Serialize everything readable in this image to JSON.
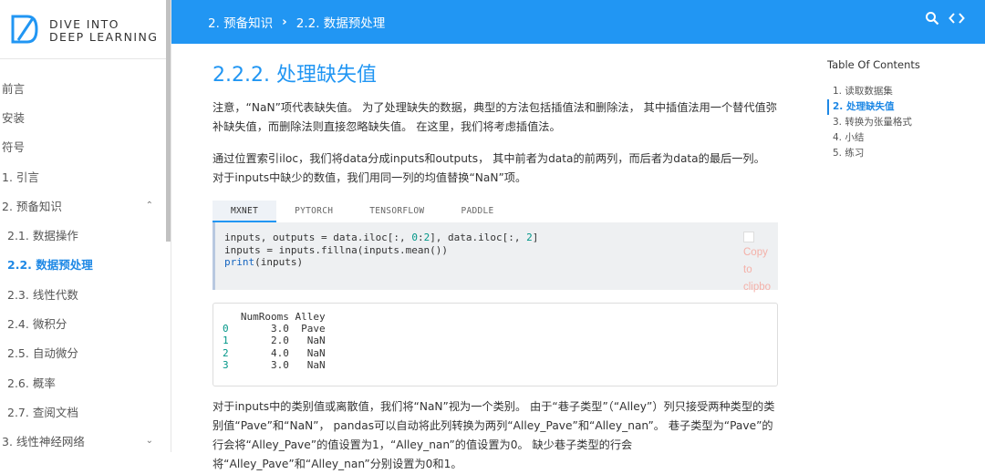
{
  "logo": {
    "line1": "DIVE INTO",
    "line2": "DEEP LEARNING"
  },
  "sidebar": {
    "items": [
      {
        "label": "前言",
        "sub": false
      },
      {
        "label": "安装",
        "sub": false
      },
      {
        "label": "符号",
        "sub": false
      },
      {
        "label": "1. 引言",
        "sub": false
      },
      {
        "label": "2. 预备知识",
        "sub": false,
        "chevron": "^"
      },
      {
        "label": "2.1. 数据操作",
        "sub": true
      },
      {
        "label": "2.2. 数据预处理",
        "sub": true,
        "active": true
      },
      {
        "label": "2.3. 线性代数",
        "sub": true
      },
      {
        "label": "2.4. 微积分",
        "sub": true
      },
      {
        "label": "2.5. 自动微分",
        "sub": true
      },
      {
        "label": "2.6. 概率",
        "sub": true
      },
      {
        "label": "2.7. 查阅文档",
        "sub": true
      },
      {
        "label": "3. 线性神经网络",
        "sub": false,
        "chevron": "v"
      }
    ]
  },
  "header": {
    "crumb1": "2. 预备知识",
    "sep": "›",
    "crumb2": "2.2. 数据预处理",
    "icons": [
      "search-icon",
      "code-icon"
    ],
    "color": "#2196f3"
  },
  "main": {
    "title": "2.2.2. 处理缺失值",
    "para1": "注意，“NaN”项代表缺失值。 为了处理缺失的数据，典型的方法包括插值法和删除法， 其中插值法用一个替代值弥补缺失值，而删除法则直接忽略缺失值。 在这里，我们将考虑插值法。",
    "para2": "通过位置索引iloc，我们将data分成inputs和outputs， 其中前者为data的前两列，而后者为data的最后一列。 对于inputs中缺少的数值，我们用同一列的均值替换“NaN”项。",
    "tabs": [
      "MXNET",
      "PYTORCH",
      "TENSORFLOW",
      "PADDLE"
    ],
    "copy_label": "Copy to clipbo",
    "output_header": "   NumRooms Alley",
    "output_rows": [
      {
        "idx": "0",
        "rest": "       3.0  Pave"
      },
      {
        "idx": "1",
        "rest": "       2.0   NaN"
      },
      {
        "idx": "2",
        "rest": "       4.0   NaN"
      },
      {
        "idx": "3",
        "rest": "       3.0   NaN"
      }
    ],
    "para3": "对于inputs中的类别值或离散值，我们将“NaN”视为一个类别。 由于“巷子类型”（“Alley”）列只接受两种类型的类别值“Pave”和“NaN”， pandas可以自动将此列转换为两列“Alley_Pave”和“Alley_nan”。 巷子类型为“Pave”的行会将“Alley_Pave”的值设置为1，“Alley_nan”的值设置为0。 缺少巷子类型的行会将“Alley_Pave”和“Alley_nan”分别设置为0和1。"
  },
  "toc": {
    "title": "Table Of Contents",
    "items": [
      {
        "label": "1. 读取数据集"
      },
      {
        "label": "2. 处理缺失值",
        "active": true
      },
      {
        "label": "3. 转换为张量格式"
      },
      {
        "label": "4. 小结"
      },
      {
        "label": "5. 练习"
      }
    ]
  }
}
